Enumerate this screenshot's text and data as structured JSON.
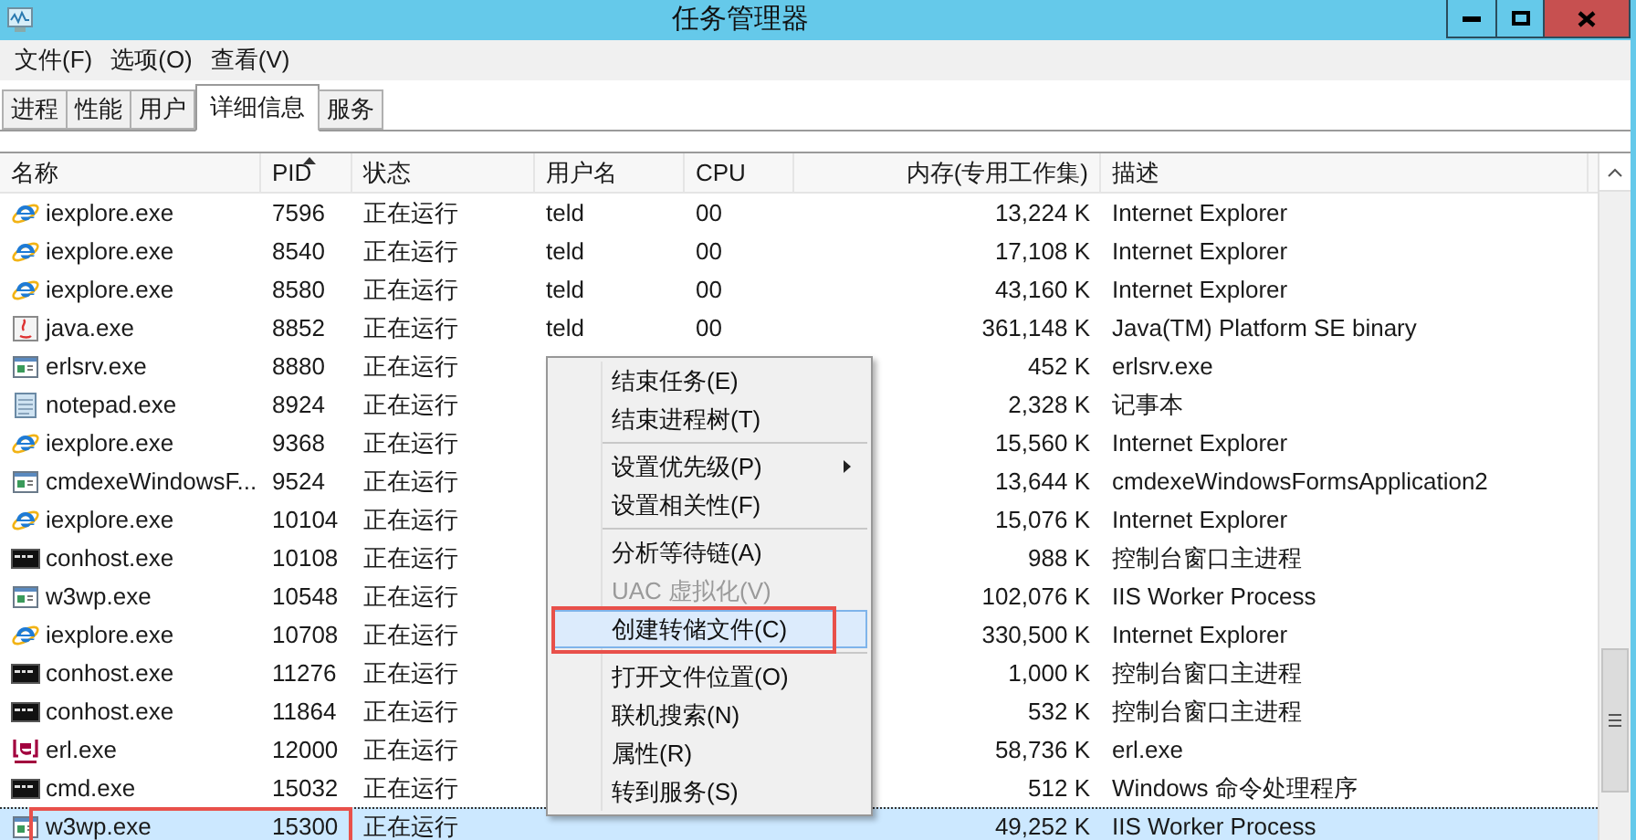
{
  "window": {
    "title": "任务管理器"
  },
  "menu_bar": [
    "文件(F)",
    "选项(O)",
    "查看(V)"
  ],
  "tabs": [
    {
      "label": "进程",
      "selected": false
    },
    {
      "label": "性能",
      "selected": false
    },
    {
      "label": "用户",
      "selected": false
    },
    {
      "label": "详细信息",
      "selected": true
    },
    {
      "label": "服务",
      "selected": false
    }
  ],
  "table": {
    "columns": [
      {
        "label": "名称",
        "sorted": false
      },
      {
        "label": "PID",
        "sorted": true
      },
      {
        "label": "状态",
        "sorted": false
      },
      {
        "label": "用户名",
        "sorted": false
      },
      {
        "label": "CPU",
        "sorted": false
      },
      {
        "label": "内存(专用工作集)",
        "sorted": false
      },
      {
        "label": "描述",
        "sorted": false
      }
    ],
    "rows": [
      {
        "kind": "ie",
        "name": "iexplore.exe",
        "pid": "7596",
        "status": "正在运行",
        "user": "teld",
        "cpu": "00",
        "memory": "13,224 K",
        "description": "Internet Explorer",
        "selected": false,
        "marked": false
      },
      {
        "kind": "ie",
        "name": "iexplore.exe",
        "pid": "8540",
        "status": "正在运行",
        "user": "teld",
        "cpu": "00",
        "memory": "17,108 K",
        "description": "Internet Explorer",
        "selected": false,
        "marked": false
      },
      {
        "kind": "ie",
        "name": "iexplore.exe",
        "pid": "8580",
        "status": "正在运行",
        "user": "teld",
        "cpu": "00",
        "memory": "43,160 K",
        "description": "Internet Explorer",
        "selected": false,
        "marked": false
      },
      {
        "kind": "java",
        "name": "java.exe",
        "pid": "8852",
        "status": "正在运行",
        "user": "teld",
        "cpu": "00",
        "memory": "361,148 K",
        "description": "Java(TM) Platform SE binary",
        "selected": false,
        "marked": false
      },
      {
        "kind": "app",
        "name": "erlsrv.exe",
        "pid": "8880",
        "status": "正在运行",
        "memory": "452 K",
        "description": "erlsrv.exe",
        "selected": false,
        "marked": false
      },
      {
        "kind": "notepad",
        "name": "notepad.exe",
        "pid": "8924",
        "status": "正在运行",
        "memory": "2,328 K",
        "description": "记事本",
        "selected": false,
        "marked": false
      },
      {
        "kind": "ie",
        "name": "iexplore.exe",
        "pid": "9368",
        "status": "正在运行",
        "memory": "15,560 K",
        "description": "Internet Explorer",
        "selected": false,
        "marked": false
      },
      {
        "kind": "app",
        "name": "cmdexeWindowsF...",
        "pid": "9524",
        "status": "正在运行",
        "memory": "13,644 K",
        "description": "cmdexeWindowsFormsApplication2",
        "selected": false,
        "marked": false
      },
      {
        "kind": "ie",
        "name": "iexplore.exe",
        "pid": "10104",
        "status": "正在运行",
        "memory": "15,076 K",
        "description": "Internet Explorer",
        "selected": false,
        "marked": false
      },
      {
        "kind": "console",
        "name": "conhost.exe",
        "pid": "10108",
        "status": "正在运行",
        "memory": "988 K",
        "description": "控制台窗口主进程",
        "selected": false,
        "marked": false
      },
      {
        "kind": "app",
        "name": "w3wp.exe",
        "pid": "10548",
        "status": "正在运行",
        "memory": "102,076 K",
        "description": "IIS Worker Process",
        "selected": false,
        "marked": false
      },
      {
        "kind": "ie",
        "name": "iexplore.exe",
        "pid": "10708",
        "status": "正在运行",
        "memory": "330,500 K",
        "description": "Internet Explorer",
        "selected": false,
        "marked": false
      },
      {
        "kind": "console",
        "name": "conhost.exe",
        "pid": "11276",
        "status": "正在运行",
        "memory": "1,000 K",
        "description": "控制台窗口主进程",
        "selected": false,
        "marked": false
      },
      {
        "kind": "console",
        "name": "conhost.exe",
        "pid": "11864",
        "status": "正在运行",
        "memory": "532 K",
        "description": "控制台窗口主进程",
        "selected": false,
        "marked": false
      },
      {
        "kind": "erlang",
        "name": "erl.exe",
        "pid": "12000",
        "status": "正在运行",
        "memory": "58,736 K",
        "description": "erl.exe",
        "selected": false,
        "marked": false
      },
      {
        "kind": "console",
        "name": "cmd.exe",
        "pid": "15032",
        "status": "正在运行",
        "memory": "512 K",
        "description": "Windows 命令处理程序",
        "selected": false,
        "marked": false
      },
      {
        "kind": "app",
        "name": "w3wp.exe",
        "pid": "15300",
        "status": "正在运行",
        "memory": "49,252 K",
        "description": "IIS Worker Process",
        "selected": true,
        "marked": true
      }
    ]
  },
  "context_menu": [
    {
      "kind": "item",
      "label": "结束任务(E)",
      "disabled": false,
      "submenu": false,
      "selected": false,
      "marked": false
    },
    {
      "kind": "item",
      "label": "结束进程树(T)",
      "disabled": false,
      "submenu": false,
      "selected": false,
      "marked": false
    },
    {
      "kind": "separator"
    },
    {
      "kind": "item",
      "label": "设置优先级(P)",
      "disabled": false,
      "submenu": true,
      "selected": false,
      "marked": false
    },
    {
      "kind": "item",
      "label": "设置相关性(F)",
      "disabled": false,
      "submenu": false,
      "selected": false,
      "marked": false
    },
    {
      "kind": "separator"
    },
    {
      "kind": "item",
      "label": "分析等待链(A)",
      "disabled": false,
      "submenu": false,
      "selected": false,
      "marked": false
    },
    {
      "kind": "item",
      "label": "UAC 虚拟化(V)",
      "disabled": true,
      "submenu": false,
      "selected": false,
      "marked": false
    },
    {
      "kind": "item",
      "label": "创建转储文件(C)",
      "disabled": false,
      "submenu": false,
      "selected": true,
      "marked": true
    },
    {
      "kind": "separator"
    },
    {
      "kind": "item",
      "label": "打开文件位置(O)",
      "disabled": false,
      "submenu": false,
      "selected": false,
      "marked": false
    },
    {
      "kind": "item",
      "label": "联机搜索(N)",
      "disabled": false,
      "submenu": false,
      "selected": false,
      "marked": false
    },
    {
      "kind": "item",
      "label": "属性(R)",
      "disabled": false,
      "submenu": false,
      "selected": false,
      "marked": false
    },
    {
      "kind": "item",
      "label": "转到服务(S)",
      "disabled": false,
      "submenu": false,
      "selected": false,
      "marked": false
    }
  ]
}
